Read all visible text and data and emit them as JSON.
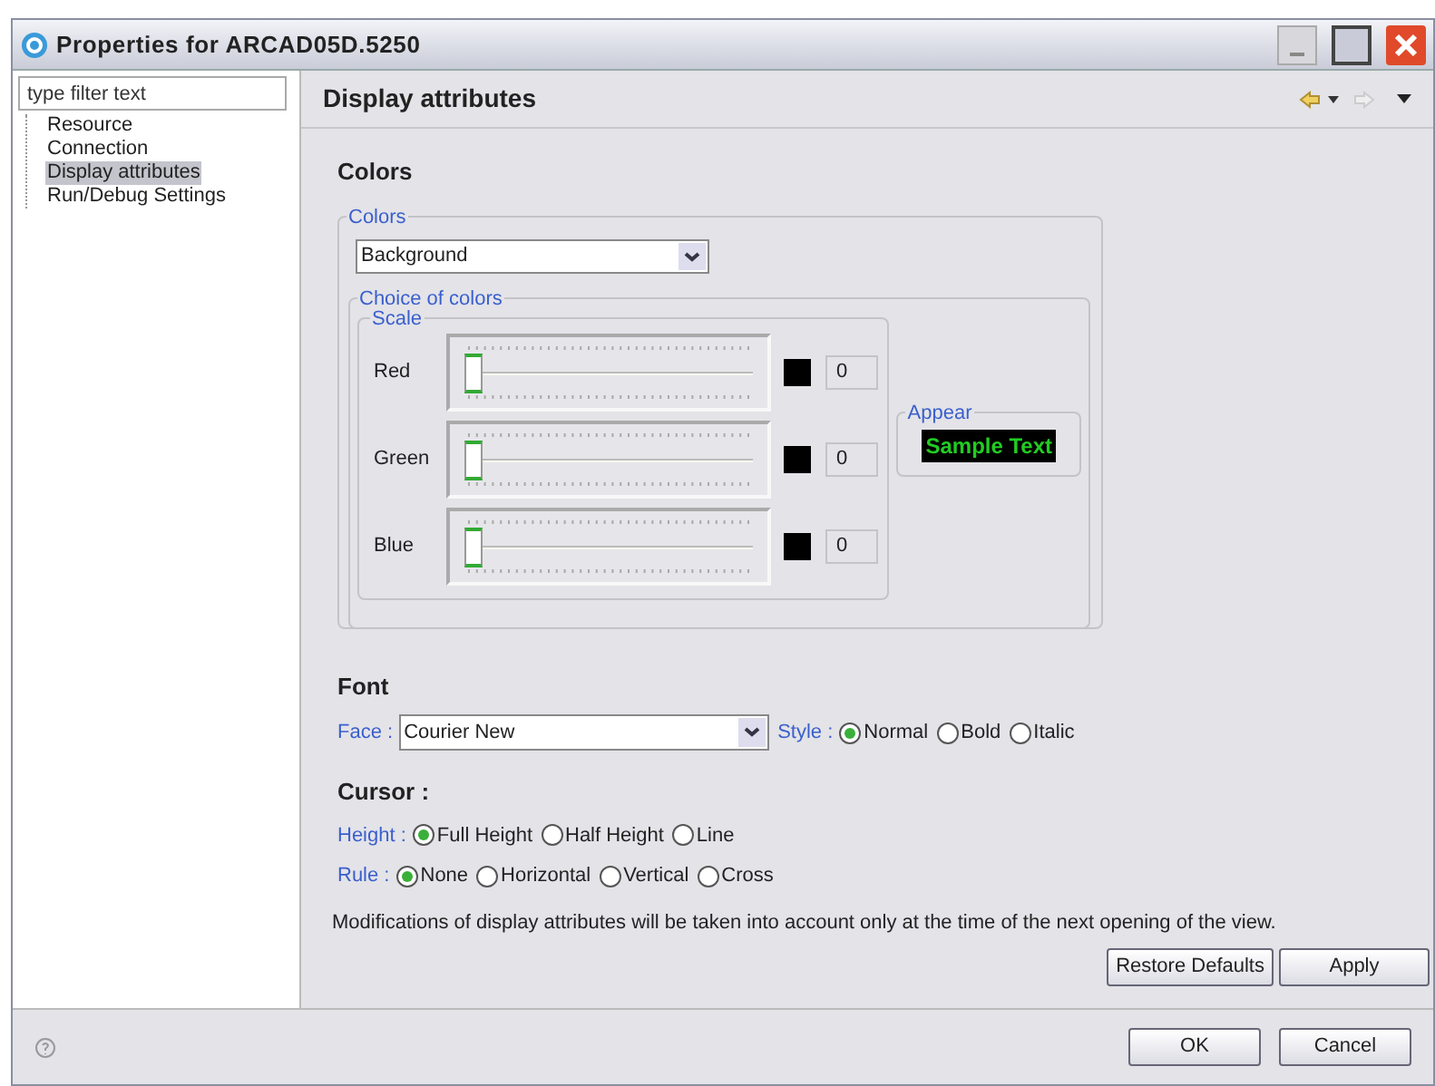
{
  "window": {
    "title": "Properties for ARCAD05D.5250"
  },
  "sidebar": {
    "filter": {
      "placeholder": "type filter text"
    },
    "items": [
      {
        "label": "Resource",
        "selected": false
      },
      {
        "label": "Connection",
        "selected": false
      },
      {
        "label": "Display attributes",
        "selected": true
      },
      {
        "label": "Run/Debug Settings",
        "selected": false
      }
    ]
  },
  "page": {
    "title": "Display attributes",
    "colors": {
      "heading": "Colors",
      "group": "Colors",
      "target": "Background",
      "choice_group": "Choice of colors",
      "scale_group": "Scale",
      "channels": [
        {
          "name": "Red",
          "level": 0,
          "color": "#000000",
          "reading": "0"
        },
        {
          "name": "Green",
          "level": 0,
          "color": "#000000",
          "reading": "0"
        },
        {
          "name": "Blue",
          "level": 0,
          "color": "#000000",
          "reading": "0"
        }
      ],
      "appear": {
        "label": "Appear",
        "sample": "Sample Text"
      }
    },
    "font": {
      "heading": "Font",
      "face_label": "Face :",
      "face": "Courier New",
      "style_label": "Style :",
      "styles": [
        {
          "label": "Normal",
          "selected": true
        },
        {
          "label": "Bold",
          "selected": false
        },
        {
          "label": "Italic",
          "selected": false
        }
      ]
    },
    "cursor": {
      "heading": "Cursor :",
      "height_label": "Height :",
      "heights": [
        {
          "label": "Full Height",
          "selected": true
        },
        {
          "label": "Half Height",
          "selected": false
        },
        {
          "label": "Line",
          "selected": false
        }
      ],
      "rule_label": "Rule :",
      "rules": [
        {
          "label": "None",
          "selected": true
        },
        {
          "label": "Horizontal",
          "selected": false
        },
        {
          "label": "Vertical",
          "selected": false
        },
        {
          "label": "Cross",
          "selected": false
        }
      ]
    },
    "note": "Modifications of display attributes will be taken into account only at the time of the next opening of the view.",
    "buttons": [
      "Restore Defaults",
      "Apply"
    ]
  },
  "footer": {
    "buttons": [
      "OK",
      "Cancel"
    ]
  }
}
